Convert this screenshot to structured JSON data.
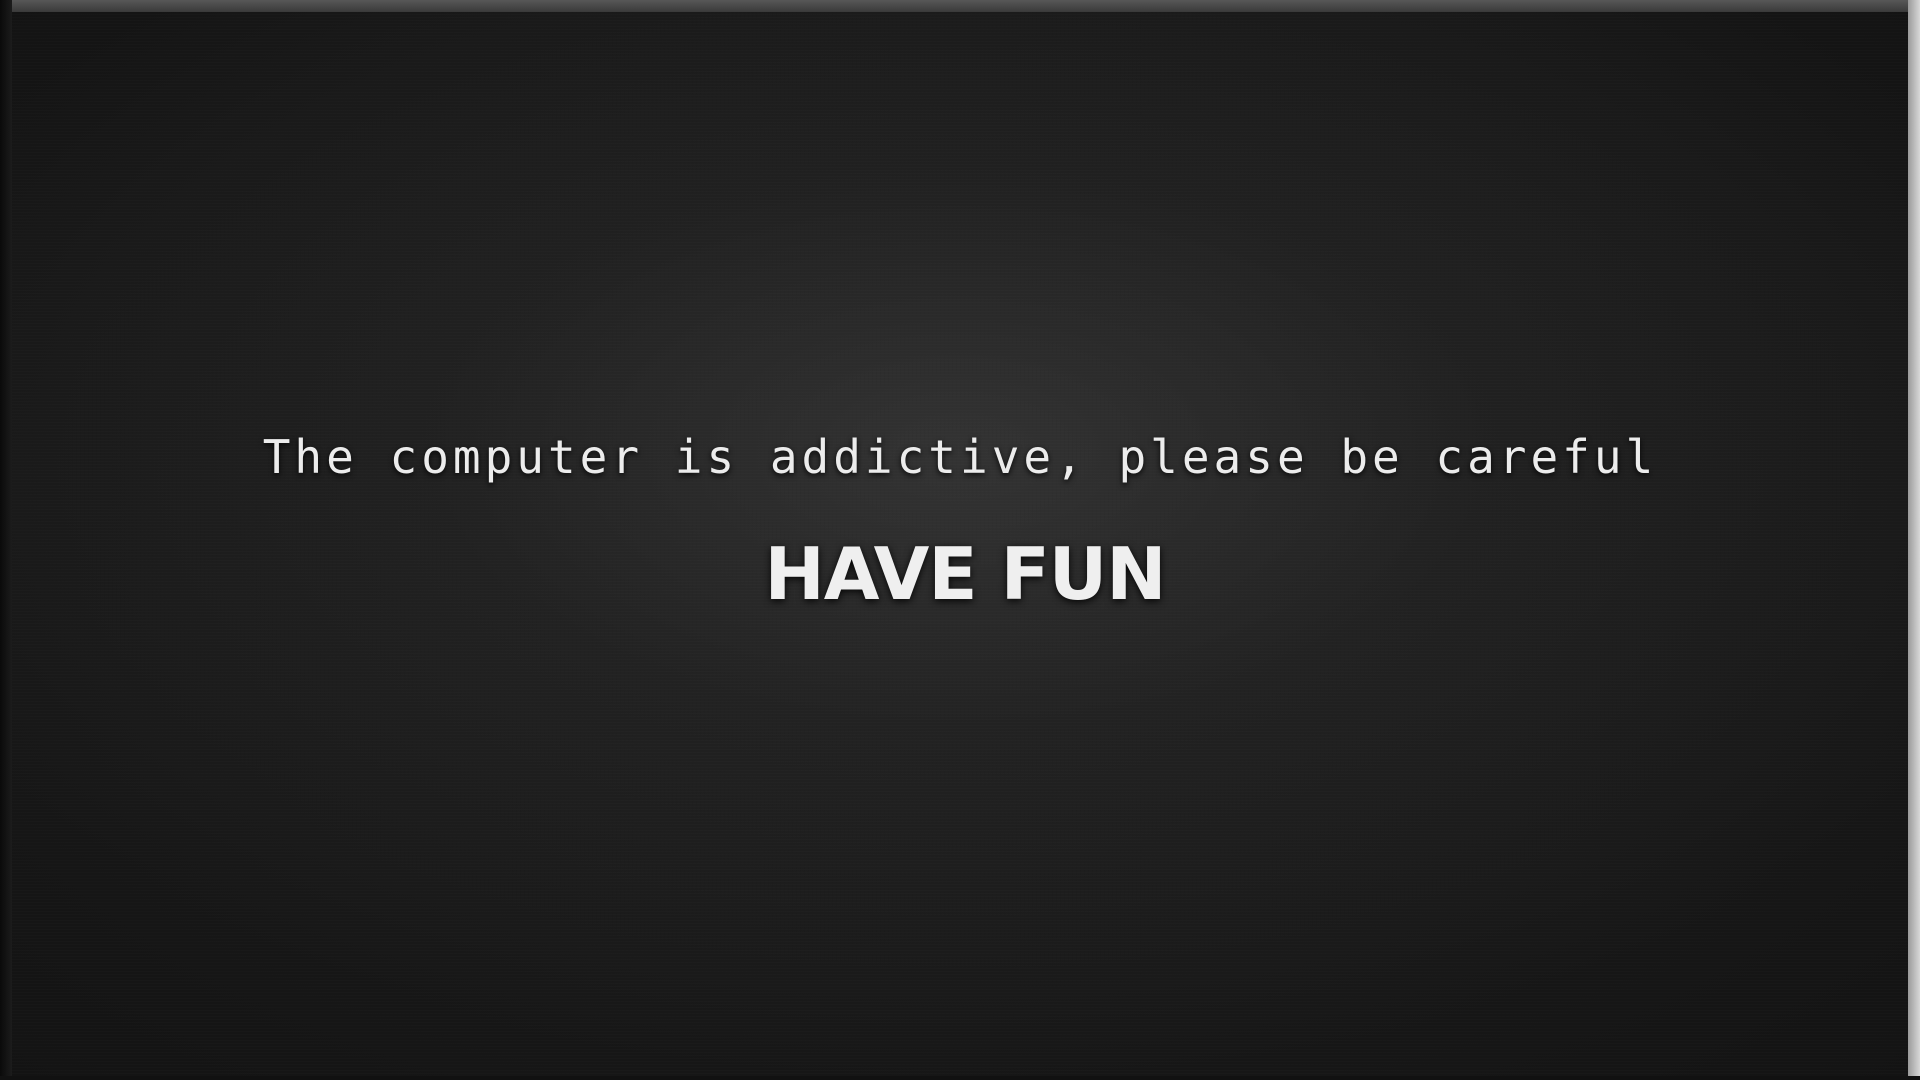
{
  "wallpaper": {
    "tagline": "The computer is addictive, please be careful",
    "headline": "HAVE FUN"
  },
  "colors": {
    "background": "#1a1a1a",
    "text": "#ececec"
  }
}
